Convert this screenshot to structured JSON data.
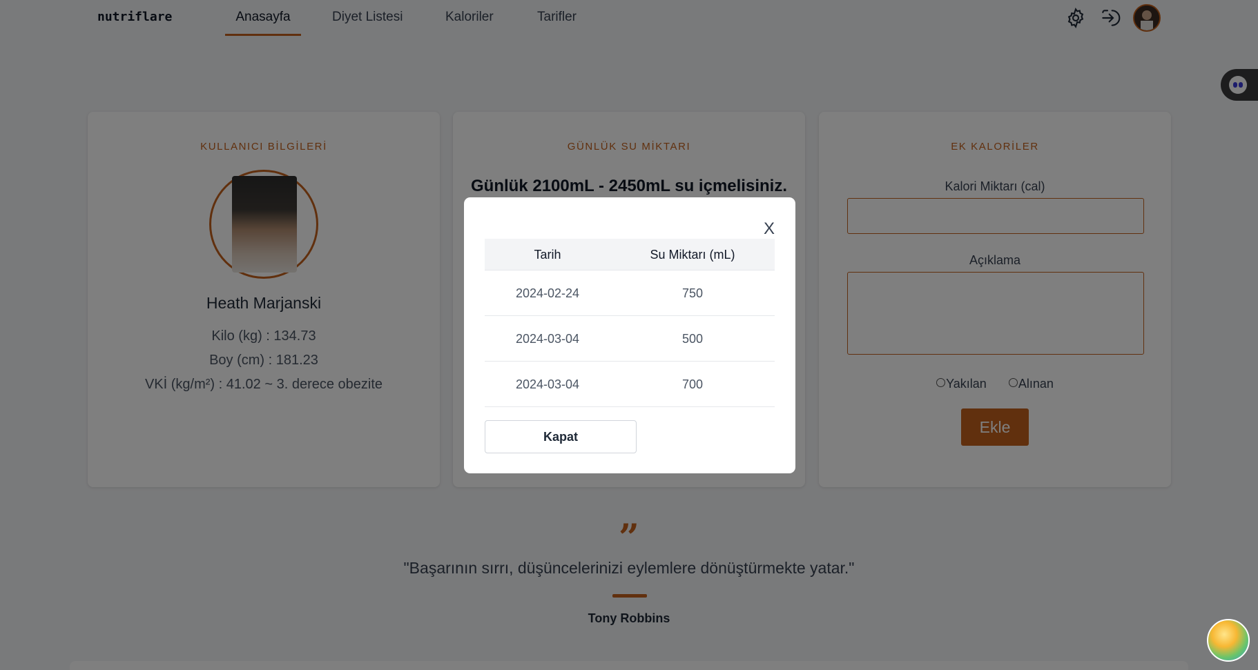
{
  "brand": "nutriflare",
  "nav": {
    "items": [
      "Anasayfa",
      "Diyet Listesi",
      "Kaloriler",
      "Tarifler"
    ],
    "active": "Anasayfa"
  },
  "user_card": {
    "title": "KULLANICI BİLGİLERİ",
    "name": "Heath Marjanski",
    "weight": "Kilo (kg) : 134.73",
    "height": "Boy (cm) : 181.23",
    "bmi": "VKİ (kg/m²) : 41.02 ~ 3. derece obezite"
  },
  "water_card": {
    "title": "GÜNLÜK SU MİKTARI",
    "recommendation": "Günlük 2100mL - 2450mL su içmelisiniz."
  },
  "calorie_card": {
    "title": "EK KALORİLER",
    "amount_label": "Kalori Miktarı (cal)",
    "description_label": "Açıklama",
    "radio_burned": "Yakılan",
    "radio_taken": "Alınan",
    "add_button": "Ekle"
  },
  "quote": {
    "mark": "”",
    "text": "\"Başarının sırrı, düşüncelerinizi eylemlere dönüştürmekte yatar.\"",
    "author": "Tony Robbins"
  },
  "modal": {
    "close_label": "X",
    "columns": [
      "Tarih",
      "Su Miktarı (mL)"
    ],
    "rows": [
      {
        "date": "2024-02-24",
        "amount": "750"
      },
      {
        "date": "2024-03-04",
        "amount": "500"
      },
      {
        "date": "2024-03-04",
        "amount": "700"
      }
    ],
    "close_button": "Kapat"
  },
  "colors": {
    "accent": "#c2601c",
    "overlay": "rgba(0,0,0,0.5)"
  },
  "icons": [
    "gear-icon",
    "logout-icon",
    "avatar",
    "chatbot-icon",
    "beach-widget-icon"
  ]
}
